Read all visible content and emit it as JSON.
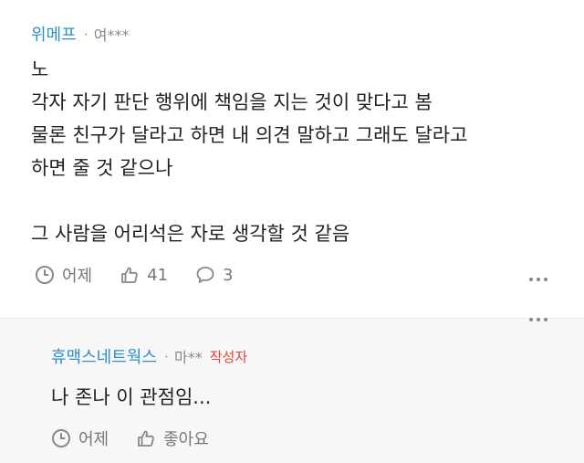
{
  "comment": {
    "source": "위메프",
    "user": "여***",
    "body_lines": [
      "노",
      "각자 자기 판단 행위에 책임을 지는 것이 맞다고 봄",
      "물론 친구가 달라고 하면 내 의견 말하고 그래도 달라고",
      "하면 줄 것 같으나",
      "",
      "그 사람을 어리석은 자로 생각할 것 같음"
    ],
    "time": "어제",
    "likes": "41",
    "replies": "3"
  },
  "reply": {
    "source": "휴맥스네트웍스",
    "user": "마**",
    "author_tag": "작성자",
    "body": "나 존나 이 관점임...",
    "time": "어제",
    "like_label": "좋아요"
  },
  "icons": [
    "clock-icon",
    "thumbs-up-icon",
    "speech-bubble-icon",
    "more-dots-icon"
  ]
}
